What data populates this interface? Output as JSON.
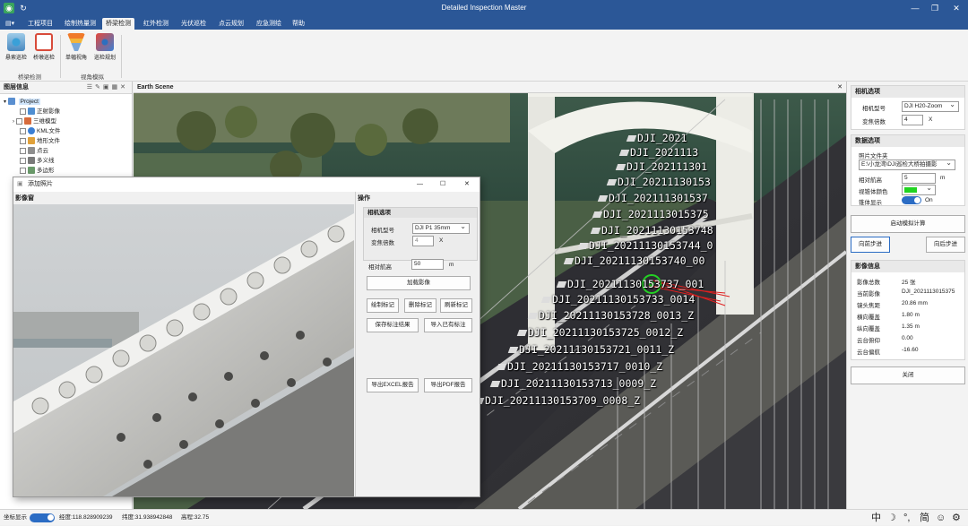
{
  "window": {
    "title": "Detailed Inspection Master",
    "min": "—",
    "max": "❐",
    "close": "✕"
  },
  "menu": {
    "items": [
      "工程项目",
      "绘制热量测",
      "桥梁检测",
      "红外检测",
      "光伏巡检",
      "点云规划",
      "应急测绘",
      "帮助"
    ],
    "active_index": 2,
    "app_menu": "▤▾"
  },
  "ribbon": {
    "buttons": [
      {
        "label": "悬索巡检",
        "icon": "suspension-inspect-icon"
      },
      {
        "label": "桥墩巡检",
        "icon": "pier-inspect-icon"
      },
      {
        "label": "单幅视角",
        "icon": "single-view-icon"
      },
      {
        "label": "巡检规划",
        "icon": "inspect-plan-icon"
      }
    ],
    "groups": [
      "桥梁检测",
      "视角模拟"
    ]
  },
  "left_panel": {
    "title": "图层信息",
    "tree": [
      {
        "label": "Project",
        "level": 0,
        "checkbox": false,
        "expanded": true
      },
      {
        "label": "正射影像",
        "level": 1
      },
      {
        "label": "三维模型",
        "level": 1,
        "expander": true
      },
      {
        "label": "KML文件",
        "level": 1
      },
      {
        "label": "地形文件",
        "level": 1
      },
      {
        "label": "点云",
        "level": 1
      },
      {
        "label": "多义线",
        "level": 1
      },
      {
        "label": "多边形",
        "level": 1
      }
    ]
  },
  "scene": {
    "title": "Earth Scene",
    "labels": [
      "DJI_2021",
      "DJI_2021113",
      "DJI_202111301",
      "DJI_20211130153",
      "DJI_202111301537",
      "DJI_2021113015375",
      "DJI_20211130153748",
      "DJI_20211130153744_0",
      "DJI_20211130153740_00",
      "DJI_20211130153737_001",
      "DJI_20211130153733_0014",
      "DJI_20211130153728_0013_Z",
      "DJI_20211130153725_0012_Z",
      "DJI_20211130153721_0011_Z",
      "DJI_20211130153717_0010_Z",
      "DJI_20211130153713_0009_Z",
      "DJI_20211130153709_0008_Z"
    ]
  },
  "dialog": {
    "title": "添加照片",
    "image_panel_title": "影像窗",
    "ops_title": "操作",
    "camera": {
      "header": "相机选项",
      "model_label": "相机型号",
      "model_value": "DJI P1 35mm",
      "zoom_label": "变焦倍数",
      "zoom_value": "4",
      "zoom_unit": "X"
    },
    "altitude_label": "相对航高",
    "altitude_value": "50",
    "altitude_unit": "m",
    "buttons": {
      "load": "加载影像",
      "draw": "绘制标记",
      "delete": "删除标记",
      "refresh": "刷新标记",
      "save": "保存标注结果",
      "import": "导入已有标注",
      "export_excel": "导出EXCEL报告",
      "export_pdf": "导出PDF报告"
    }
  },
  "right_panel": {
    "camera": {
      "header": "相机选项",
      "model_label": "相机型号",
      "model_value": "DJI H20-Zoom",
      "zoom_label": "变焦倍数",
      "zoom_value": "4",
      "zoom_unit": "X"
    },
    "data": {
      "header": "数据选项",
      "folder_label": "照片文件夹",
      "folder_value": "E:\\小龙湾\\DJI巡检大桥拍摄影",
      "altitude_label": "相对航高",
      "altitude_value": "5",
      "altitude_unit": "m",
      "cone_color_label": "视锥体颜色",
      "cone_color": "#21d321",
      "cone_show_label": "锥体显示",
      "cone_show_value": "On"
    },
    "buttons": {
      "simulate": "启动模拟计算",
      "prev": "向前步进",
      "next": "向后步进",
      "close": "关闭"
    },
    "info": {
      "header": "影像信息",
      "rows": [
        {
          "k": "影像总数",
          "v": "25 张"
        },
        {
          "k": "当前影像",
          "v": "DJI_2021113015375"
        },
        {
          "k": "镜头焦距",
          "v": "20.86 mm"
        },
        {
          "k": "横向覆盖",
          "v": "1.80 m"
        },
        {
          "k": "纵向覆盖",
          "v": "1.35 m"
        },
        {
          "k": "云台俯仰",
          "v": "0.00"
        },
        {
          "k": "云台偏航",
          "v": "-16.60"
        }
      ]
    }
  },
  "status": {
    "coord_label": "坐标显示",
    "lon": "经度:118.828909239",
    "lat": "纬度:31.938942848",
    "alt": "高程:32.75",
    "ime": [
      "中",
      "☽",
      "°,",
      "简",
      "☺",
      "⚙"
    ]
  }
}
